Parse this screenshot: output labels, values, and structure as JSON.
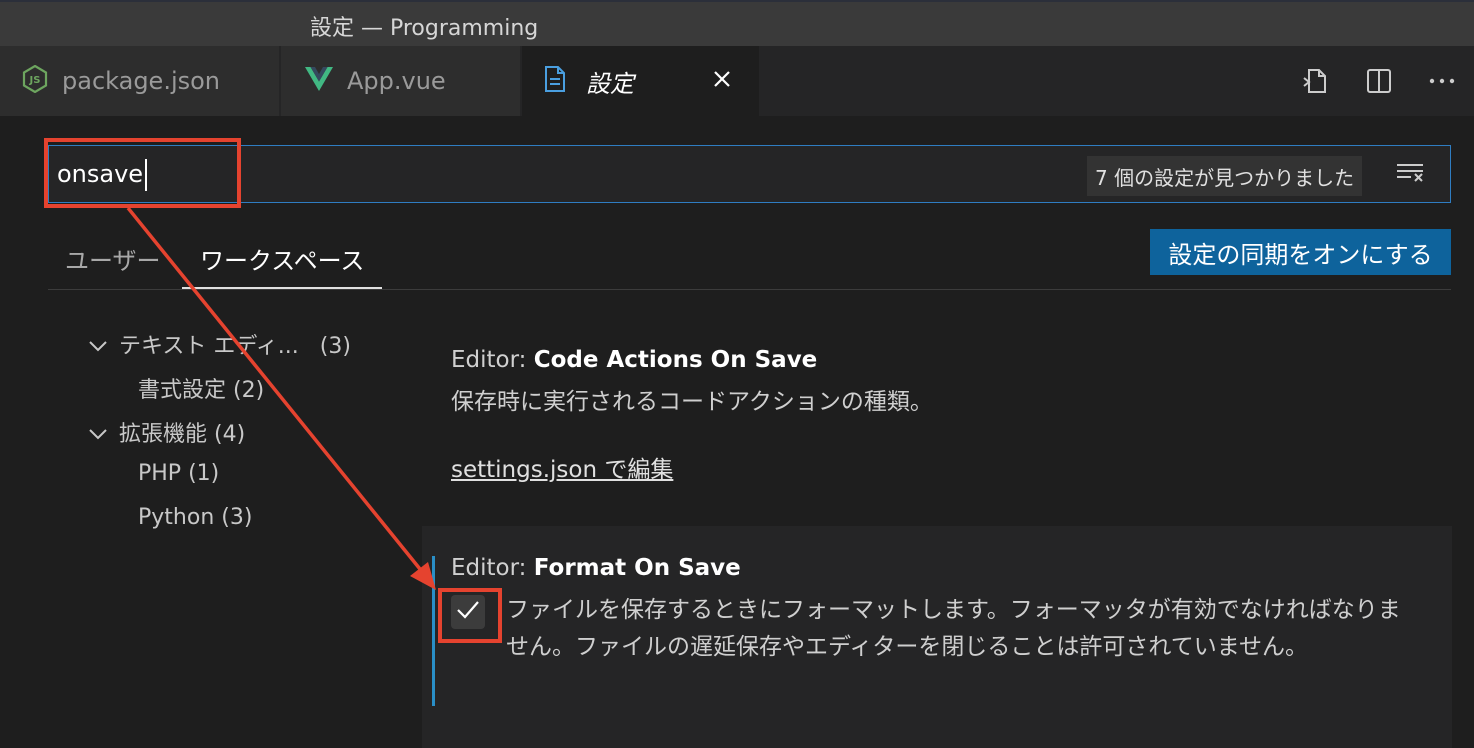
{
  "window": {
    "title": "設定 — Programming"
  },
  "tabs": [
    {
      "label": "package.json",
      "icon": "nodejs-icon"
    },
    {
      "label": "App.vue",
      "icon": "vue-icon"
    },
    {
      "label": "設定",
      "icon": "file-icon",
      "active": true
    }
  ],
  "search": {
    "value": "onsave",
    "result_count": "7 個の設定が見つかりました"
  },
  "scopes": [
    {
      "label": "ユーザー"
    },
    {
      "label": "ワークスペース",
      "active": true
    }
  ],
  "sync_button": "設定の同期をオンにする",
  "toc": [
    {
      "label": "テキスト エディ...",
      "count": "(3)"
    },
    {
      "label": "書式設定 (2)"
    },
    {
      "label": "拡張機能 (4)"
    },
    {
      "label": "PHP (1)"
    },
    {
      "label": "Python (3)"
    }
  ],
  "settings": [
    {
      "prefix": "Editor: ",
      "name": "Code Actions On Save",
      "description": "保存時に実行されるコードアクションの種類。",
      "link": "settings.json で編集"
    },
    {
      "prefix": "Editor: ",
      "name": "Format On Save",
      "description": "ファイルを保存するときにフォーマットします。フォーマッタが有効でなければなりません。ファイルの遅延保存やエディターを閉じることは許可されていません。",
      "checked": true
    }
  ],
  "colors": {
    "accent": "#0e639c",
    "focus_border": "#2f7dc2",
    "annotation": "#e5432f",
    "vue_green": "#41b883",
    "node_green": "#6da55f"
  }
}
